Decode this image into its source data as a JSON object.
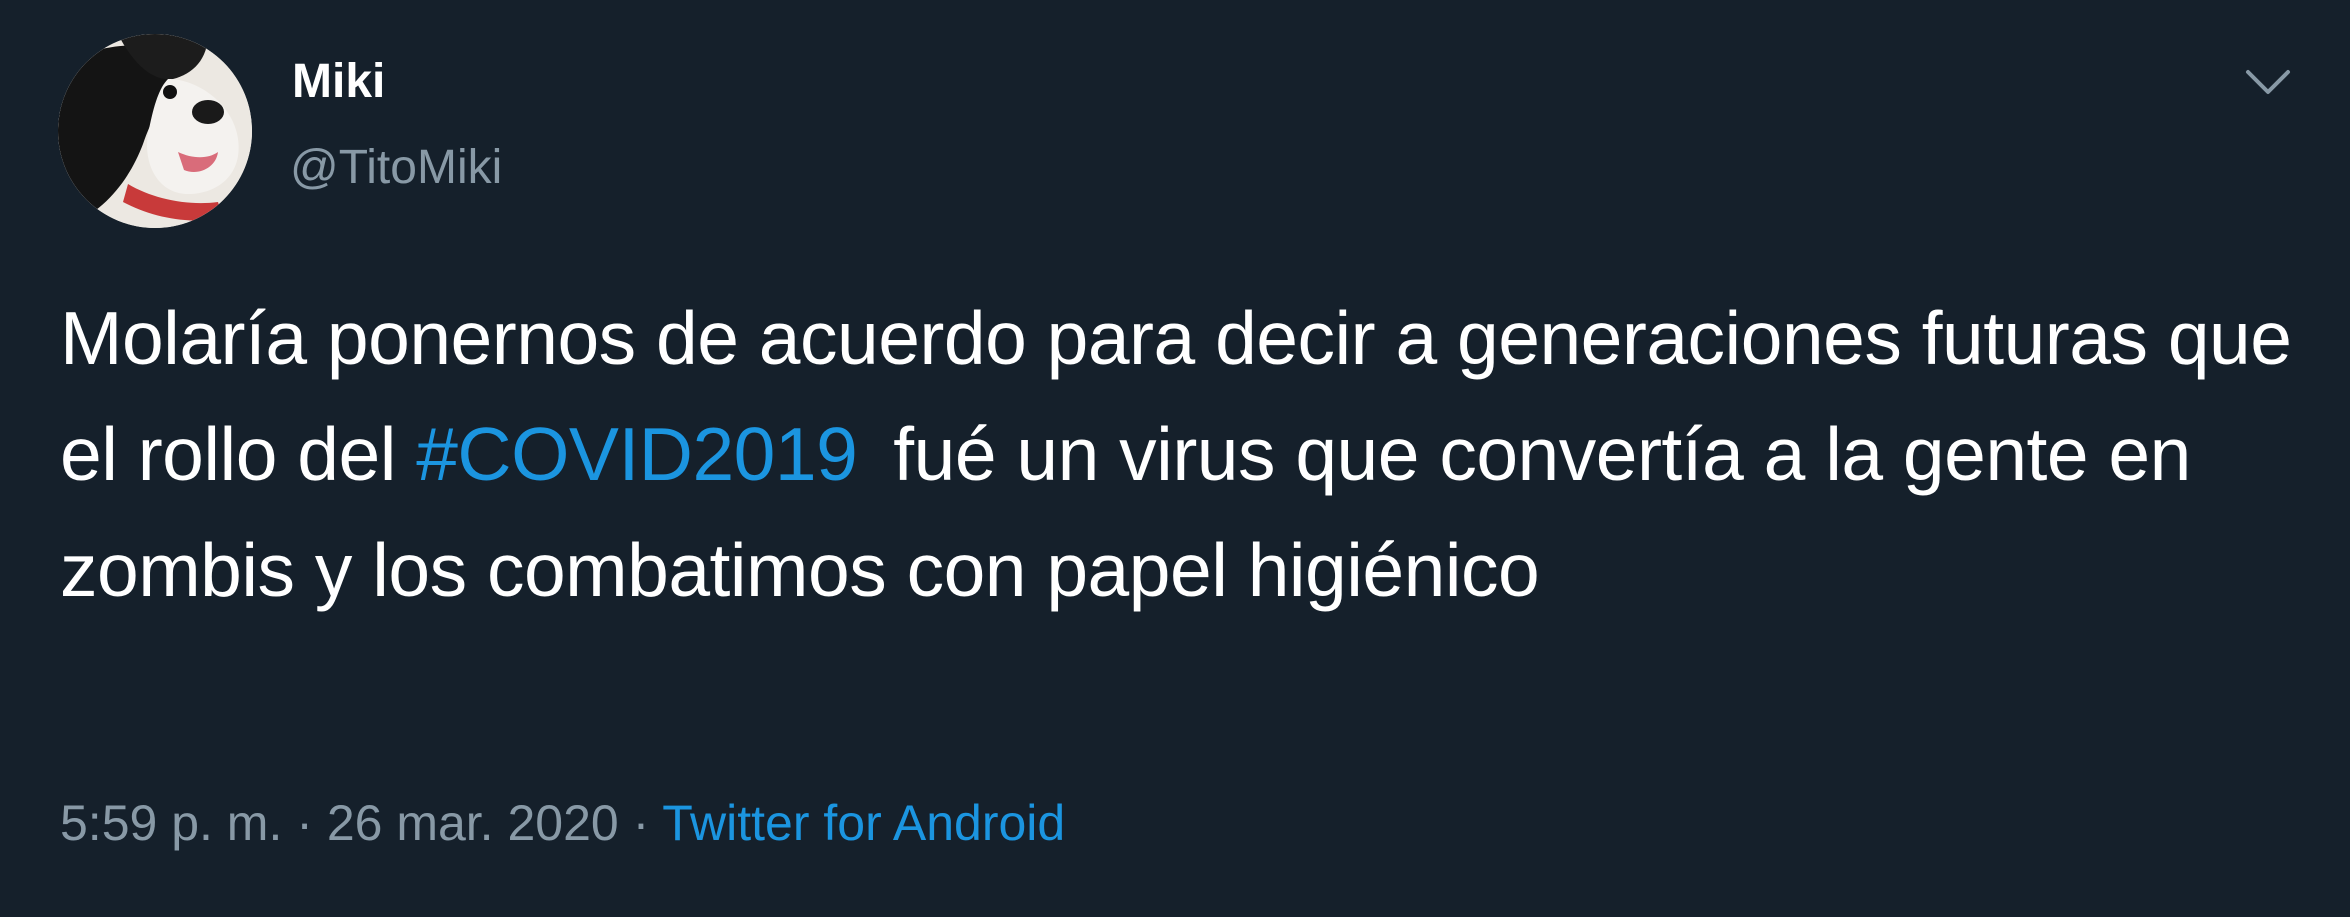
{
  "tweet": {
    "author": {
      "display_name": "Miki",
      "handle": "@TitoMiki",
      "avatar_icon": "dog-avatar"
    },
    "text_before_hashtag": "Molaría ponernos de acuerdo para decir a generaciones futuras que el rollo del",
    "hashtag": "#COVID2019",
    "text_after_hashtag": "fué un virus que convertía a la gente en zombis y los combatimos con papel higiénico",
    "time": "5:59 p. m.",
    "date": "26 mar. 2020",
    "separator": "·",
    "source": "Twitter for Android",
    "menu_icon": "chevron-down-icon"
  },
  "colors": {
    "background": "#15202b",
    "text": "#ffffff",
    "secondary": "#8899a6",
    "link": "#1b95e0"
  }
}
